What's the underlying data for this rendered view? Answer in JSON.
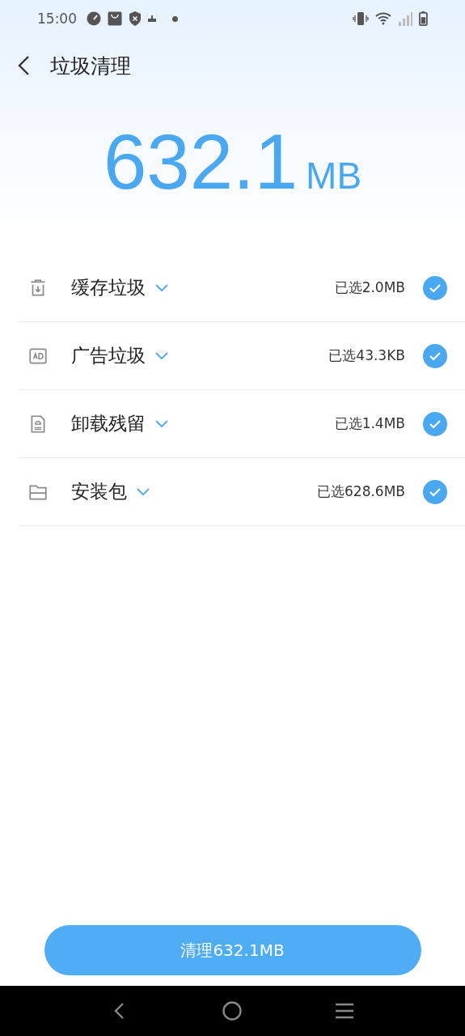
{
  "status_bar": {
    "time": "15:00"
  },
  "header": {
    "title": "垃圾清理"
  },
  "summary": {
    "amount": "632.1",
    "unit": "MB"
  },
  "items": [
    {
      "kind": "cache",
      "label": "缓存垃圾",
      "selected_size": "已选2.0MB",
      "checked": true
    },
    {
      "kind": "ad",
      "label": "广告垃圾",
      "selected_size": "已选43.3KB",
      "checked": true
    },
    {
      "kind": "apk",
      "label": "卸载残留",
      "selected_size": "已选1.4MB",
      "checked": true
    },
    {
      "kind": "package",
      "label": "安装包",
      "selected_size": "已选628.6MB",
      "checked": true
    }
  ],
  "clean_button": {
    "label": "清理632.1MB"
  }
}
